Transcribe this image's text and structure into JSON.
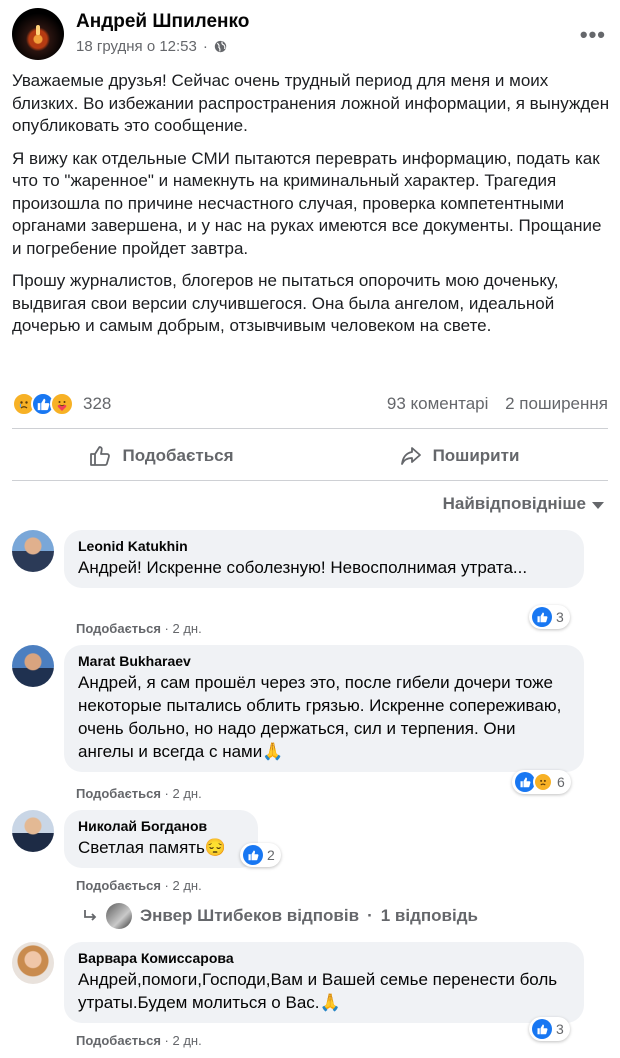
{
  "post": {
    "author": "Андрей Шпиленко",
    "timestamp": "18 грудня о 12:53",
    "separator": "·",
    "more_label": "•••",
    "paragraphs": [
      "Уважаемые друзья! Сейчас очень трудный период для меня и моих близких. Во избежании распространения ложной информации, я вынужден опубликовать это сообщение.",
      "Я вижу как отдельные СМИ пытаются переврать информацию, подать как что то \"жаренное\" и намекнуть на криминальный характер. Трагедия произошла по причине несчастного случая, проверка компетентными органами завершена, и у нас на руках имеются все документы. Прощание и погребение пройдет завтра.",
      "Прошу журналистов, блогеров не пытаться опорочить мою доченьку, выдвигая свои версии случившегося. Она была ангелом, идеальной дочерью и самым добрым, отзывчивым человеком на свете."
    ],
    "reaction_count": "328",
    "comments_count": "93 коментарі",
    "shares_count": "2 поширення"
  },
  "actions": {
    "like_label": "Подобається",
    "share_label": "Поширити"
  },
  "sort": {
    "label": "Найвідповідніше"
  },
  "comments": [
    {
      "author": "Leonid Katukhin",
      "text": "Андрей! Искренне соболезную! Невосполнимая утрата...",
      "like_label": "Подобається",
      "time": "2 дн.",
      "reactions": "3"
    },
    {
      "author": "Marat Bukharaev",
      "text": "Андрей, я сам прошёл через это, после гибели дочери тоже некоторые пытались облить грязью. Искренне сопереживаю, очень больно, но надо держаться, сил и терпения. Они ангелы и всегда с нами🙏",
      "like_label": "Подобається",
      "time": "2 дн.",
      "reactions": "6"
    },
    {
      "author": "Николай Богданов",
      "text": "Светлая память😔",
      "like_label": "Подобається",
      "time": "2 дн.",
      "reactions": "2"
    },
    {
      "author": "Варвара Комиссарова",
      "text": "Андрей,помоги,Господи,Вам и Вашей семье перенести боль утраты.Будем молиться о Вас.🙏",
      "like_label": "Подобається",
      "time": "2 дн.",
      "reactions": "3"
    }
  ],
  "replies": {
    "text": "Энвер Штибеков відповів",
    "separator": "·",
    "count_label": "1 відповідь"
  },
  "colors": {
    "like_blue": "#1877f2",
    "sad_yellow": "#f7b125",
    "secondary_text": "#65676b",
    "bubble_bg": "#f0f2f5"
  }
}
